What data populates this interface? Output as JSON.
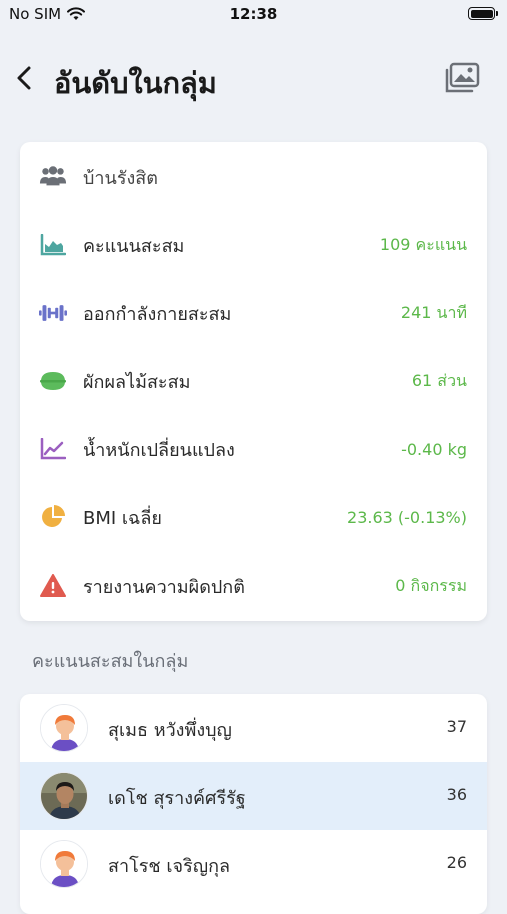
{
  "status_bar": {
    "carrier": "No SIM",
    "time": "12:38"
  },
  "nav": {
    "title": "อันดับในกลุ่ม"
  },
  "summary": {
    "group_name": "บ้านรังสิต",
    "rows": [
      {
        "icon": "area-chart-icon",
        "label": "คะแนนสะสม",
        "value": "109 คะแนน"
      },
      {
        "icon": "dumbbell-icon",
        "label": "ออกกำลังกายสะสม",
        "value": "241 นาที"
      },
      {
        "icon": "food-bowl-icon",
        "label": "ผักผลไม้สะสม",
        "value": "61 ส่วน"
      },
      {
        "icon": "line-chart-icon",
        "label": "น้ำหนักเปลี่ยนแปลง",
        "value": "-0.40 kg"
      },
      {
        "icon": "pie-chart-icon",
        "label": "BMI เฉลี่ย",
        "value": "23.63 (-0.13%)"
      },
      {
        "icon": "warning-icon",
        "label": "รายงานความผิดปกติ",
        "value": "0 กิจกรรม"
      }
    ]
  },
  "members_section": {
    "title": "คะแนนสะสมในกลุ่ม",
    "members": [
      {
        "name": "สุเมธ หวังพึ่งบุญ",
        "score": "37",
        "avatar": "cartoon-avatar"
      },
      {
        "name": "เดโช สุรางค์ศรีรัฐ",
        "score": "36",
        "avatar": "photo-avatar",
        "highlighted": true
      },
      {
        "name": "สาโรช เจริญกุล",
        "score": "26",
        "avatar": "cartoon-avatar"
      }
    ]
  },
  "colors": {
    "value_green": "#5cb84a",
    "highlight_row": "#e3eefa",
    "background": "#eef1f6"
  }
}
